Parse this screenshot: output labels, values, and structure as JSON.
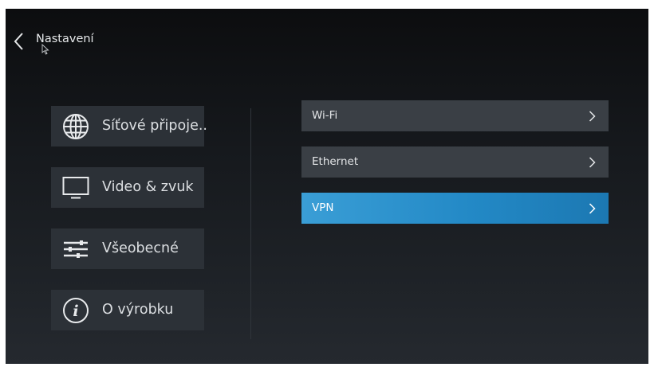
{
  "header": {
    "title": "Nastavení"
  },
  "sidebar": {
    "items": [
      {
        "label": "Síťové připoje..",
        "icon": "globe-icon"
      },
      {
        "label": "Video & zvuk",
        "icon": "monitor-icon"
      },
      {
        "label": "Všeobecné",
        "icon": "sliders-icon"
      },
      {
        "label": "O výrobku",
        "icon": "info-icon"
      }
    ]
  },
  "network": {
    "items": [
      {
        "label": "Wi-Fi",
        "selected": false
      },
      {
        "label": "Ethernet",
        "selected": false
      },
      {
        "label": "VPN",
        "selected": true
      }
    ]
  },
  "colors": {
    "accent": "#2389c6",
    "tile": "#2c3137",
    "row": "#3a3f45"
  }
}
